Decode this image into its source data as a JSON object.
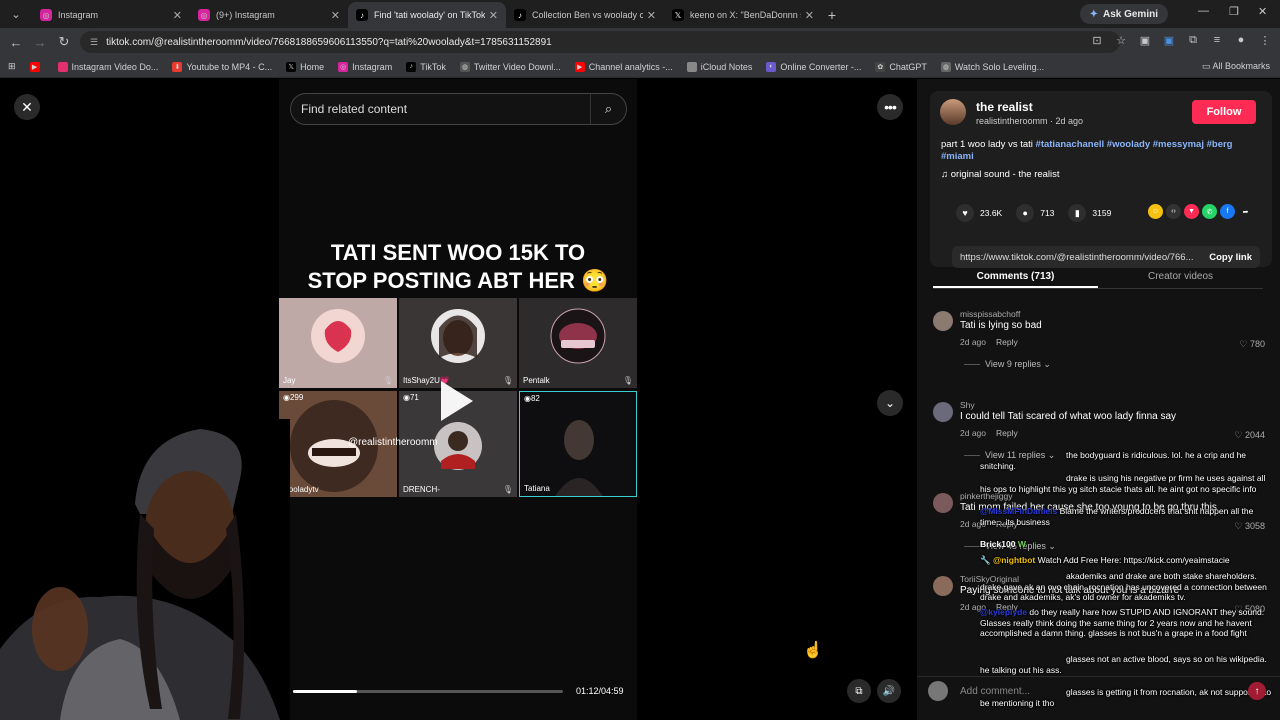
{
  "browser": {
    "tabs": [
      {
        "title": "Instagram",
        "active": false,
        "color": "#d6249f"
      },
      {
        "title": "(9+) Instagram",
        "active": false,
        "color": "#d6249f"
      },
      {
        "title": "Find 'tati woolady' on TikTok | T",
        "active": true,
        "color": "#000000"
      },
      {
        "title": "Collection Ben vs woolady crea",
        "active": false,
        "color": "#000000"
      },
      {
        "title": "keeno on X: \"BenDaDonnn spe",
        "active": false,
        "color": "#000000"
      }
    ],
    "gemini_label": "Ask Gemini",
    "url": "tiktok.com/@realistintheroomm/video/7668188659606113550?q=tati%20woolady&t=1785631152891",
    "bookmarks": [
      {
        "label": "",
        "color": "#ff0000"
      },
      {
        "label": "Instagram Video Do...",
        "color": "#e1306c"
      },
      {
        "label": "Youtube to MP4 - C...",
        "color": "#e63b2e"
      },
      {
        "label": "Home",
        "color": "#000000"
      },
      {
        "label": "Instagram",
        "color": "#d6249f"
      },
      {
        "label": "TikTok",
        "color": "#000000"
      },
      {
        "label": "Twitter Video Downl...",
        "color": "#888888"
      },
      {
        "label": "Channel analytics -...",
        "color": "#ff0000"
      },
      {
        "label": "iCloud Notes",
        "color": "#999999"
      },
      {
        "label": "Online Converter -...",
        "color": "#6a5acd"
      },
      {
        "label": "ChatGPT",
        "color": "#444444"
      },
      {
        "label": "Watch Solo Leveling...",
        "color": "#666666"
      }
    ],
    "all_bookmarks": "All Bookmarks"
  },
  "video": {
    "search_placeholder": "Find related content",
    "headline_line1": "TATI SENT WOO 15K TO",
    "headline_line2": "STOP POSTING ABT HER 😳",
    "participants": [
      {
        "name": "Jay",
        "count": ""
      },
      {
        "name": "ItsShay2U💗",
        "count": ""
      },
      {
        "name": "Pentalk",
        "count": ""
      },
      {
        "name": "wooladytv",
        "count": "299"
      },
      {
        "name": "DRENCH-",
        "count": "71"
      },
      {
        "name": "Tatiana",
        "count": "82"
      }
    ],
    "watermark": "@realistintheroomm",
    "progress": 0.237,
    "timecode": "01:12/04:59"
  },
  "panel": {
    "author_name": "the realist",
    "author_handle": "realistintheroomm · 2d ago",
    "follow_label": "Follow",
    "caption_text": "part 1 woo lady vs tati ",
    "caption_tags": "#tatianachanell #woolady #messymaj #berg",
    "caption_tags2": "#miami",
    "sound": "original sound - the realist",
    "likes": "23.6K",
    "comments_count": "713",
    "saves": "3159",
    "link": "https://www.tiktok.com/@realistintheroomm/video/766...",
    "copy_link": "Copy link",
    "tab_comments": "Comments (713)",
    "tab_creator": "Creator videos",
    "add_comment": "Add comment..."
  },
  "comments": [
    {
      "user": "misspissabchoff",
      "text": "Tati is lying so bad",
      "date": "2d ago",
      "reply": "Reply",
      "likes": "780",
      "replies": "View 9 replies"
    },
    {
      "user": "Shy",
      "text": "I could tell Tati scared of what woo lady finna say",
      "date": "2d ago",
      "reply": "Reply",
      "likes": "2044",
      "replies": "View 11 replies"
    },
    {
      "user": "pinkerthejiggy",
      "text": "Tati mom failed her cause she too young to be go thru this",
      "date": "2d ago",
      "reply": "Reply",
      "likes": "3058",
      "replies": "View 45 replies"
    },
    {
      "user": "ToriiSkyOriginal",
      "text": "Paying someone to not talk about you is a bizarre",
      "date": "2d ago",
      "reply": "Reply",
      "likes": "5080",
      "replies": ""
    }
  ],
  "chat": [
    {
      "user": "",
      "text": "the bodyguard is ridiculous. lol. he a crip and he snitching."
    },
    {
      "user": "",
      "text": "drake is using his negative pr firm he uses against all his ops to highlight this yg sitch stacie thats all. he aint got no specific info"
    },
    {
      "user": "@MissMFinDaniels",
      "text": "Blame the writers/producers that shit happen all the time... its business"
    },
    {
      "user": "Brick100",
      "text": "W"
    },
    {
      "user": "@nightbot",
      "text": "Watch Add Free Here: https://kick.com/yeaimstacie"
    },
    {
      "user": "",
      "text": "akademiks and drake are both stake shareholders. drake gave ak an ovo chain. rocnation has uncovered a connection between drake and akademiks, ak's old owner for akademiks tv."
    },
    {
      "user": "@kyleplyde",
      "text": "do they really hare how STUPID AND IGNORANT they sound. Glasses really think doing the same thing for 2 years now and he havent accomplished a damn thing. glasses is not bus'n a grape in a food fight"
    },
    {
      "user": "",
      "text": "glasses not an active blood, says so on his wikipedia. he talking out his ass."
    },
    {
      "user": "",
      "text": "glasses is getting it from rocnation, ak not supposed to be mentioning it tho"
    }
  ]
}
